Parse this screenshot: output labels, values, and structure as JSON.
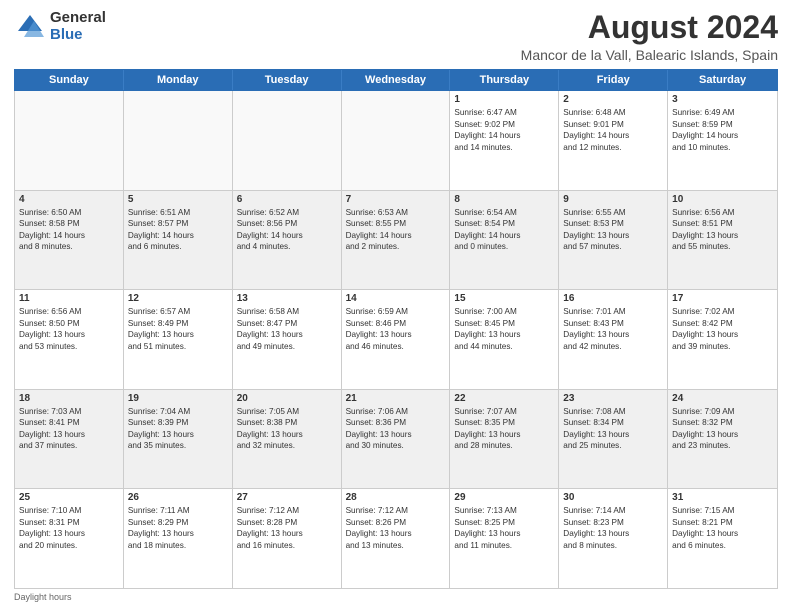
{
  "logo": {
    "general": "General",
    "blue": "Blue"
  },
  "title": "August 2024",
  "subtitle": "Mancor de la Vall, Balearic Islands, Spain",
  "days": [
    "Sunday",
    "Monday",
    "Tuesday",
    "Wednesday",
    "Thursday",
    "Friday",
    "Saturday"
  ],
  "footer": "Daylight hours",
  "weeks": [
    [
      {
        "day": "",
        "content": ""
      },
      {
        "day": "",
        "content": ""
      },
      {
        "day": "",
        "content": ""
      },
      {
        "day": "",
        "content": ""
      },
      {
        "day": "1",
        "content": "Sunrise: 6:47 AM\nSunset: 9:02 PM\nDaylight: 14 hours\nand 14 minutes."
      },
      {
        "day": "2",
        "content": "Sunrise: 6:48 AM\nSunset: 9:01 PM\nDaylight: 14 hours\nand 12 minutes."
      },
      {
        "day": "3",
        "content": "Sunrise: 6:49 AM\nSunset: 8:59 PM\nDaylight: 14 hours\nand 10 minutes."
      }
    ],
    [
      {
        "day": "4",
        "content": "Sunrise: 6:50 AM\nSunset: 8:58 PM\nDaylight: 14 hours\nand 8 minutes."
      },
      {
        "day": "5",
        "content": "Sunrise: 6:51 AM\nSunset: 8:57 PM\nDaylight: 14 hours\nand 6 minutes."
      },
      {
        "day": "6",
        "content": "Sunrise: 6:52 AM\nSunset: 8:56 PM\nDaylight: 14 hours\nand 4 minutes."
      },
      {
        "day": "7",
        "content": "Sunrise: 6:53 AM\nSunset: 8:55 PM\nDaylight: 14 hours\nand 2 minutes."
      },
      {
        "day": "8",
        "content": "Sunrise: 6:54 AM\nSunset: 8:54 PM\nDaylight: 14 hours\nand 0 minutes."
      },
      {
        "day": "9",
        "content": "Sunrise: 6:55 AM\nSunset: 8:53 PM\nDaylight: 13 hours\nand 57 minutes."
      },
      {
        "day": "10",
        "content": "Sunrise: 6:56 AM\nSunset: 8:51 PM\nDaylight: 13 hours\nand 55 minutes."
      }
    ],
    [
      {
        "day": "11",
        "content": "Sunrise: 6:56 AM\nSunset: 8:50 PM\nDaylight: 13 hours\nand 53 minutes."
      },
      {
        "day": "12",
        "content": "Sunrise: 6:57 AM\nSunset: 8:49 PM\nDaylight: 13 hours\nand 51 minutes."
      },
      {
        "day": "13",
        "content": "Sunrise: 6:58 AM\nSunset: 8:47 PM\nDaylight: 13 hours\nand 49 minutes."
      },
      {
        "day": "14",
        "content": "Sunrise: 6:59 AM\nSunset: 8:46 PM\nDaylight: 13 hours\nand 46 minutes."
      },
      {
        "day": "15",
        "content": "Sunrise: 7:00 AM\nSunset: 8:45 PM\nDaylight: 13 hours\nand 44 minutes."
      },
      {
        "day": "16",
        "content": "Sunrise: 7:01 AM\nSunset: 8:43 PM\nDaylight: 13 hours\nand 42 minutes."
      },
      {
        "day": "17",
        "content": "Sunrise: 7:02 AM\nSunset: 8:42 PM\nDaylight: 13 hours\nand 39 minutes."
      }
    ],
    [
      {
        "day": "18",
        "content": "Sunrise: 7:03 AM\nSunset: 8:41 PM\nDaylight: 13 hours\nand 37 minutes."
      },
      {
        "day": "19",
        "content": "Sunrise: 7:04 AM\nSunset: 8:39 PM\nDaylight: 13 hours\nand 35 minutes."
      },
      {
        "day": "20",
        "content": "Sunrise: 7:05 AM\nSunset: 8:38 PM\nDaylight: 13 hours\nand 32 minutes."
      },
      {
        "day": "21",
        "content": "Sunrise: 7:06 AM\nSunset: 8:36 PM\nDaylight: 13 hours\nand 30 minutes."
      },
      {
        "day": "22",
        "content": "Sunrise: 7:07 AM\nSunset: 8:35 PM\nDaylight: 13 hours\nand 28 minutes."
      },
      {
        "day": "23",
        "content": "Sunrise: 7:08 AM\nSunset: 8:34 PM\nDaylight: 13 hours\nand 25 minutes."
      },
      {
        "day": "24",
        "content": "Sunrise: 7:09 AM\nSunset: 8:32 PM\nDaylight: 13 hours\nand 23 minutes."
      }
    ],
    [
      {
        "day": "25",
        "content": "Sunrise: 7:10 AM\nSunset: 8:31 PM\nDaylight: 13 hours\nand 20 minutes."
      },
      {
        "day": "26",
        "content": "Sunrise: 7:11 AM\nSunset: 8:29 PM\nDaylight: 13 hours\nand 18 minutes."
      },
      {
        "day": "27",
        "content": "Sunrise: 7:12 AM\nSunset: 8:28 PM\nDaylight: 13 hours\nand 16 minutes."
      },
      {
        "day": "28",
        "content": "Sunrise: 7:12 AM\nSunset: 8:26 PM\nDaylight: 13 hours\nand 13 minutes."
      },
      {
        "day": "29",
        "content": "Sunrise: 7:13 AM\nSunset: 8:25 PM\nDaylight: 13 hours\nand 11 minutes."
      },
      {
        "day": "30",
        "content": "Sunrise: 7:14 AM\nSunset: 8:23 PM\nDaylight: 13 hours\nand 8 minutes."
      },
      {
        "day": "31",
        "content": "Sunrise: 7:15 AM\nSunset: 8:21 PM\nDaylight: 13 hours\nand 6 minutes."
      }
    ]
  ]
}
